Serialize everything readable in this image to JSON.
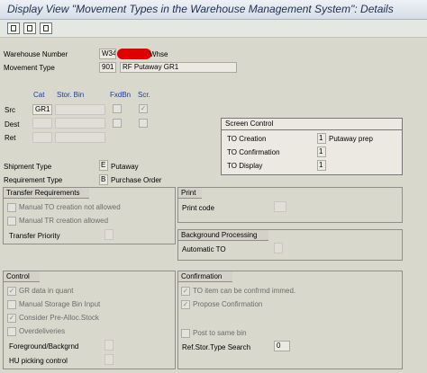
{
  "window": {
    "title": "Display View \"Movement Types in the Warehouse Management System\": Details"
  },
  "toolbar": {
    "buttons": [
      "save-icon",
      "display-icon",
      "details-icon"
    ]
  },
  "header": {
    "warehouse_label": "Warehouse Number",
    "warehouse_value": "W34",
    "warehouse_desc": "Whse",
    "movement_label": "Movement Type",
    "movement_value": "901",
    "movement_desc": "RF Putaway GR1"
  },
  "bins": {
    "col_cat": "Cat",
    "col_stor": "Stor. Bin",
    "col_fxd": "FxdBn",
    "col_scr": "Scr.",
    "rows": [
      {
        "label": "Src",
        "cat": "GR1",
        "scr": "✓"
      },
      {
        "label": "Dest",
        "cat": "",
        "scr": ""
      },
      {
        "label": "Ret",
        "cat": "",
        "scr": ""
      }
    ]
  },
  "screen_control": {
    "title": "Screen Control",
    "rows": [
      {
        "label": "TO Creation",
        "value": "1",
        "desc": "Putaway prep"
      },
      {
        "label": "TO Confirmation",
        "value": "1",
        "desc": ""
      },
      {
        "label": "TO Display",
        "value": "1",
        "desc": ""
      }
    ]
  },
  "shipment": {
    "ship_label": "Shipment Type",
    "ship_value": "E",
    "ship_desc": "Putaway",
    "req_label": "Requirement Type",
    "req_value": "B",
    "req_desc": "Purchase Order"
  },
  "transfer_req": {
    "title": "Transfer Requirements",
    "manual_to": "Manual TO creation not allowed",
    "manual_tr": "Manual TR creation allowed",
    "priority": "Transfer Priority"
  },
  "print": {
    "title": "Print",
    "code": "Print code"
  },
  "background": {
    "title": "Background Processing",
    "auto_to": "Automatic TO"
  },
  "control": {
    "title": "Control",
    "gr_data": "GR data in quant",
    "manual_storage": "Manual Storage Bin Input",
    "consider": "Consider Pre-Alloc.Stock",
    "overdeliveries": "Overdeliveries",
    "foreground": "Foreground/Backgrnd",
    "hu_picking": "HU picking control"
  },
  "confirmation": {
    "title": "Confirmation",
    "to_item": "TO item can be confrmd immed.",
    "propose": "Propose Confirmation",
    "post": "Post to same bin",
    "ref_label": "Ref.Stor.Type Search",
    "ref_value": "0"
  },
  "checks": {
    "mark": "✓"
  }
}
